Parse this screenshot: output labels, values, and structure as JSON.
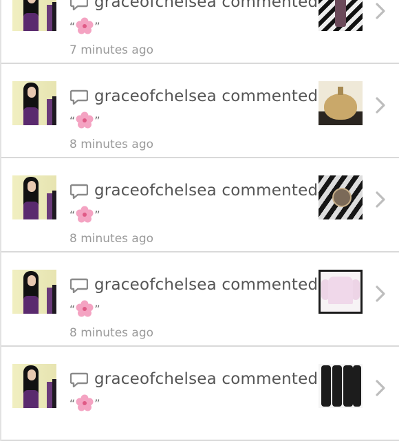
{
  "notifications": [
    {
      "username": "graceofchelsea",
      "action": "commented:",
      "quote_open": "“",
      "quote_close": "”",
      "comment_icon": "flower-emoji",
      "time": "7 minutes ago",
      "thumbnail": "zebra-print-bottle"
    },
    {
      "username": "graceofchelsea",
      "action": "commented:",
      "quote_open": "“",
      "quote_close": "”",
      "comment_icon": "flower-emoji",
      "time": "8 minutes ago",
      "thumbnail": "heart-perfume"
    },
    {
      "username": "graceofchelsea",
      "action": "commented:",
      "quote_open": "“",
      "quote_close": "”",
      "comment_icon": "flower-emoji",
      "time": "8 minutes ago",
      "thumbnail": "wrist-watch"
    },
    {
      "username": "graceofchelsea",
      "action": "commented:",
      "quote_open": "“",
      "quote_close": "”",
      "comment_icon": "flower-emoji",
      "time": "8 minutes ago",
      "thumbnail": "pink-sweater"
    },
    {
      "username": "graceofchelsea",
      "action": "commented:",
      "quote_open": "“",
      "quote_close": "”",
      "comment_icon": "flower-emoji",
      "time": "",
      "thumbnail": "black-leggings"
    }
  ],
  "colors": {
    "text_primary": "#555555",
    "text_time": "#9a9a9a",
    "divider": "#d9d9d9",
    "flower": "#f4a3c2"
  }
}
